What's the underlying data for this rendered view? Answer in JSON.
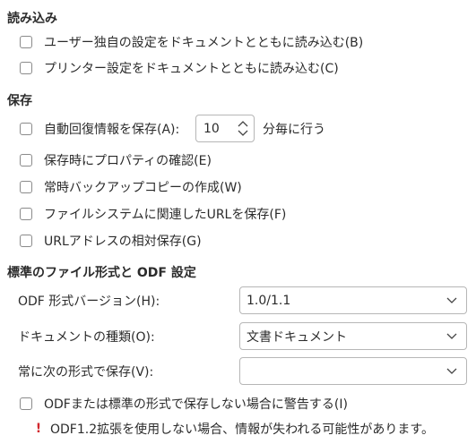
{
  "sections": {
    "load": {
      "title": "読み込み"
    },
    "save": {
      "title": "保存"
    },
    "odf": {
      "title": "標準のファイル形式と ODF 設定"
    }
  },
  "load_options": [
    {
      "label": "ユーザー独自の設定をドキュメントとともに読み込む(B)",
      "checked": false
    },
    {
      "label": "プリンター設定をドキュメントとともに読み込む(C)",
      "checked": false
    }
  ],
  "save_options": {
    "autorecovery_label": "自動回復情報を保存(A):",
    "autorecovery_minutes": "10",
    "autorecovery_suffix": "分毎に行う",
    "items": [
      {
        "label": "保存時にプロパティの確認(E)",
        "checked": false
      },
      {
        "label": "常時バックアップコピーの作成(W)",
        "checked": false
      },
      {
        "label": "ファイルシステムに関連したURLを保存(F)",
        "checked": false
      },
      {
        "label": "URLアドレスの相対保存(G)",
        "checked": false
      }
    ]
  },
  "odf_settings": {
    "version_label": "ODF 形式バージョン(H):",
    "version_value": "1.0/1.1",
    "doctype_label": "ドキュメントの種類(O):",
    "doctype_value": "文書ドキュメント",
    "saveas_label": "常に次の形式で保存(V):",
    "saveas_value": "",
    "warn_label": "ODFまたは標準の形式で保存しない場合に警告する(I)",
    "warn_checked": false,
    "notice": "ODF1.2拡張を使用しない場合、情報が失われる可能性があります。",
    "notice_icon": "warning-exclamation-icon",
    "notice_color": "#d2282e"
  }
}
